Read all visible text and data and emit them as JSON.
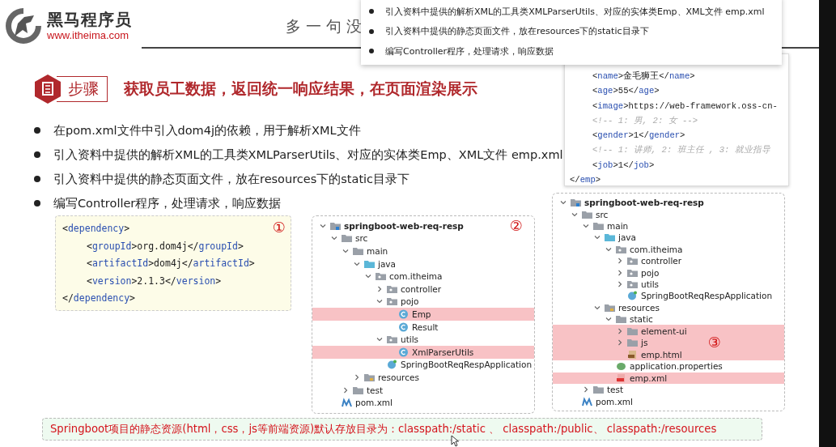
{
  "logo": {
    "name": "黑马程序员",
    "site": "www.itheima.com"
  },
  "slide_title": "多一句没",
  "step": {
    "badge": "步骤",
    "heading": "获取员工数据，返回统一响应结果，在页面渲染展示"
  },
  "bullets": [
    "在pom.xml文件中引入dom4j的依赖，用于解析XML文件",
    "引入资料中提供的解析XML的工具类XMLParserUtils、对应的实体类Emp、XML文件 emp.xml",
    "引入资料中提供的静态页面文件，放在resources下的static目录下",
    "编写Controller程序，处理请求，响应数据"
  ],
  "dependency_code": {
    "marker": "①",
    "lines": [
      {
        "indented": false,
        "tokens": [
          {
            "kind": "punct",
            "t": "<"
          },
          {
            "kind": "tag",
            "t": "dependency"
          },
          {
            "kind": "punct",
            "t": ">"
          }
        ]
      },
      {
        "indented": true,
        "tokens": [
          {
            "kind": "punct",
            "t": "<"
          },
          {
            "kind": "tag",
            "t": "groupId"
          },
          {
            "kind": "punct",
            "t": ">org.dom4j</"
          },
          {
            "kind": "tag",
            "t": "groupId"
          },
          {
            "kind": "punct",
            "t": ">"
          }
        ]
      },
      {
        "indented": true,
        "tokens": [
          {
            "kind": "punct",
            "t": "<"
          },
          {
            "kind": "tag",
            "t": "artifactId"
          },
          {
            "kind": "punct",
            "t": ">dom4j</"
          },
          {
            "kind": "tag",
            "t": "artifactId"
          },
          {
            "kind": "punct",
            "t": ">"
          }
        ]
      },
      {
        "indented": true,
        "tokens": [
          {
            "kind": "punct",
            "t": "<"
          },
          {
            "kind": "tag",
            "t": "version"
          },
          {
            "kind": "punct",
            "t": ">2.1.3</"
          },
          {
            "kind": "tag",
            "t": "version"
          },
          {
            "kind": "punct",
            "t": ">"
          }
        ]
      },
      {
        "indented": false,
        "tokens": [
          {
            "kind": "punct",
            "t": "</"
          },
          {
            "kind": "tag",
            "t": "dependency"
          },
          {
            "kind": "punct",
            "t": ">"
          }
        ]
      }
    ]
  },
  "tree_main": {
    "root": {
      "label": "springboot-web-req-resp",
      "kind": "module",
      "marker": "②",
      "expanded": true,
      "highlighted": false,
      "children": [
        {
          "label": "src",
          "kind": "folder",
          "expanded": true,
          "highlighted": false,
          "children": [
            {
              "label": "main",
              "kind": "folder",
              "expanded": true,
              "highlighted": false,
              "children": [
                {
                  "label": "java",
                  "kind": "source",
                  "expanded": true,
                  "highlighted": false,
                  "children": [
                    {
                      "label": "com.itheima",
                      "kind": "package",
                      "expanded": true,
                      "highlighted": false,
                      "children": [
                        {
                          "label": "controller",
                          "kind": "package",
                          "expanded": false,
                          "highlighted": false
                        },
                        {
                          "label": "pojo",
                          "kind": "package",
                          "expanded": true,
                          "highlighted": false,
                          "children": [
                            {
                              "label": "Emp",
                              "kind": "class",
                              "highlighted": true
                            },
                            {
                              "label": "Result",
                              "kind": "class",
                              "highlighted": false
                            }
                          ]
                        },
                        {
                          "label": "utils",
                          "kind": "package",
                          "expanded": true,
                          "highlighted": false,
                          "children": [
                            {
                              "label": "XmlParserUtils",
                              "kind": "class",
                              "highlighted": true
                            }
                          ]
                        },
                        {
                          "label": "SpringBootReqRespApplication",
                          "kind": "app",
                          "highlighted": false
                        }
                      ]
                    }
                  ]
                },
                {
                  "label": "resources",
                  "kind": "resources",
                  "expanded": false,
                  "highlighted": false
                }
              ]
            },
            {
              "label": "test",
              "kind": "folder",
              "expanded": false,
              "highlighted": false
            }
          ]
        },
        {
          "label": "pom.xml",
          "kind": "maven",
          "highlighted": false
        }
      ]
    }
  },
  "tree_static": {
    "root": {
      "label": "springboot-web-req-resp",
      "kind": "module",
      "expanded": true,
      "highlighted": false,
      "children": [
        {
          "label": "src",
          "kind": "folder",
          "expanded": true,
          "highlighted": false,
          "children": [
            {
              "label": "main",
              "kind": "folder",
              "expanded": true,
              "highlighted": false,
              "children": [
                {
                  "label": "java",
                  "kind": "source",
                  "expanded": true,
                  "highlighted": false,
                  "children": [
                    {
                      "label": "com.itheima",
                      "kind": "package",
                      "expanded": true,
                      "highlighted": false,
                      "children": [
                        {
                          "label": "controller",
                          "kind": "package",
                          "expanded": false,
                          "highlighted": false
                        },
                        {
                          "label": "pojo",
                          "kind": "package",
                          "expanded": false,
                          "highlighted": false
                        },
                        {
                          "label": "utils",
                          "kind": "package",
                          "expanded": false,
                          "highlighted": false
                        },
                        {
                          "label": "SpringBootReqRespApplication",
                          "kind": "app",
                          "highlighted": false
                        }
                      ]
                    }
                  ]
                },
                {
                  "label": "resources",
                  "kind": "resources",
                  "expanded": true,
                  "highlighted": false,
                  "children": [
                    {
                      "label": "static",
                      "kind": "folder",
                      "expanded": true,
                      "highlighted": false,
                      "children": [
                        {
                          "label": "element-ui",
                          "kind": "folder",
                          "expanded": false,
                          "highlighted": true
                        },
                        {
                          "label": "js",
                          "kind": "folder",
                          "marker": "③",
                          "expanded": false,
                          "highlighted": true
                        },
                        {
                          "label": "emp.html",
                          "kind": "html",
                          "highlighted": true
                        }
                      ]
                    },
                    {
                      "label": "application.properties",
                      "kind": "properties",
                      "highlighted": false
                    },
                    {
                      "label": "emp.xml",
                      "kind": "xml",
                      "highlighted": true
                    }
                  ]
                }
              ]
            },
            {
              "label": "test",
              "kind": "folder",
              "expanded": false,
              "highlighted": false
            }
          ]
        },
        {
          "label": "pom.xml",
          "kind": "maven",
          "highlighted": false
        }
      ]
    }
  },
  "xml_preview": {
    "lines": [
      {
        "indented": true,
        "tokens": [
          {
            "kind": "punct",
            "t": "<"
          },
          {
            "kind": "tag",
            "t": "name"
          },
          {
            "kind": "punct",
            "t": ">金毛狮王</"
          },
          {
            "kind": "tag",
            "t": "name"
          },
          {
            "kind": "punct",
            "t": ">"
          }
        ]
      },
      {
        "indented": true,
        "tokens": [
          {
            "kind": "punct",
            "t": "<"
          },
          {
            "kind": "tag",
            "t": "age"
          },
          {
            "kind": "punct",
            "t": ">55</"
          },
          {
            "kind": "tag",
            "t": "age"
          },
          {
            "kind": "punct",
            "t": ">"
          }
        ]
      },
      {
        "indented": true,
        "tokens": [
          {
            "kind": "punct",
            "t": "<"
          },
          {
            "kind": "tag",
            "t": "image"
          },
          {
            "kind": "punct",
            "t": ">https://web-framework.oss-cn-"
          }
        ]
      },
      {
        "indented": true,
        "tokens": [
          {
            "kind": "comment",
            "t": "<!-- 1: 男, 2: 女 -->"
          }
        ]
      },
      {
        "indented": true,
        "tokens": [
          {
            "kind": "punct",
            "t": "<"
          },
          {
            "kind": "tag",
            "t": "gender"
          },
          {
            "kind": "punct",
            "t": ">1</"
          },
          {
            "kind": "tag",
            "t": "gender"
          },
          {
            "kind": "punct",
            "t": ">"
          }
        ]
      },
      {
        "indented": true,
        "tokens": [
          {
            "kind": "comment",
            "t": "<!-- 1: 讲师, 2: 班主任 , 3: 就业指导"
          }
        ]
      },
      {
        "indented": true,
        "tokens": [
          {
            "kind": "punct",
            "t": "<"
          },
          {
            "kind": "tag",
            "t": "job"
          },
          {
            "kind": "punct",
            "t": ">1</"
          },
          {
            "kind": "tag",
            "t": "job"
          },
          {
            "kind": "punct",
            "t": ">"
          }
        ]
      },
      {
        "indented": false,
        "tokens": [
          {
            "kind": "punct",
            "t": "</"
          },
          {
            "kind": "tag",
            "t": "emp"
          },
          {
            "kind": "punct",
            "t": ">"
          }
        ]
      }
    ]
  },
  "popup": {
    "items": [
      "引入资料中提供的解析XML的工具类XMLParserUtils、对应的实体类Emp、XML文件 emp.xml",
      "引入资料中提供的静态页面文件，放在resources下的static目录下",
      "编写Controller程序，处理请求，响应数据"
    ]
  },
  "note": "Springboot项目的静态资源(html，css，js等前端资源)默认存放目录为：classpath:/static 、 classpath:/public、 classpath:/resources"
}
